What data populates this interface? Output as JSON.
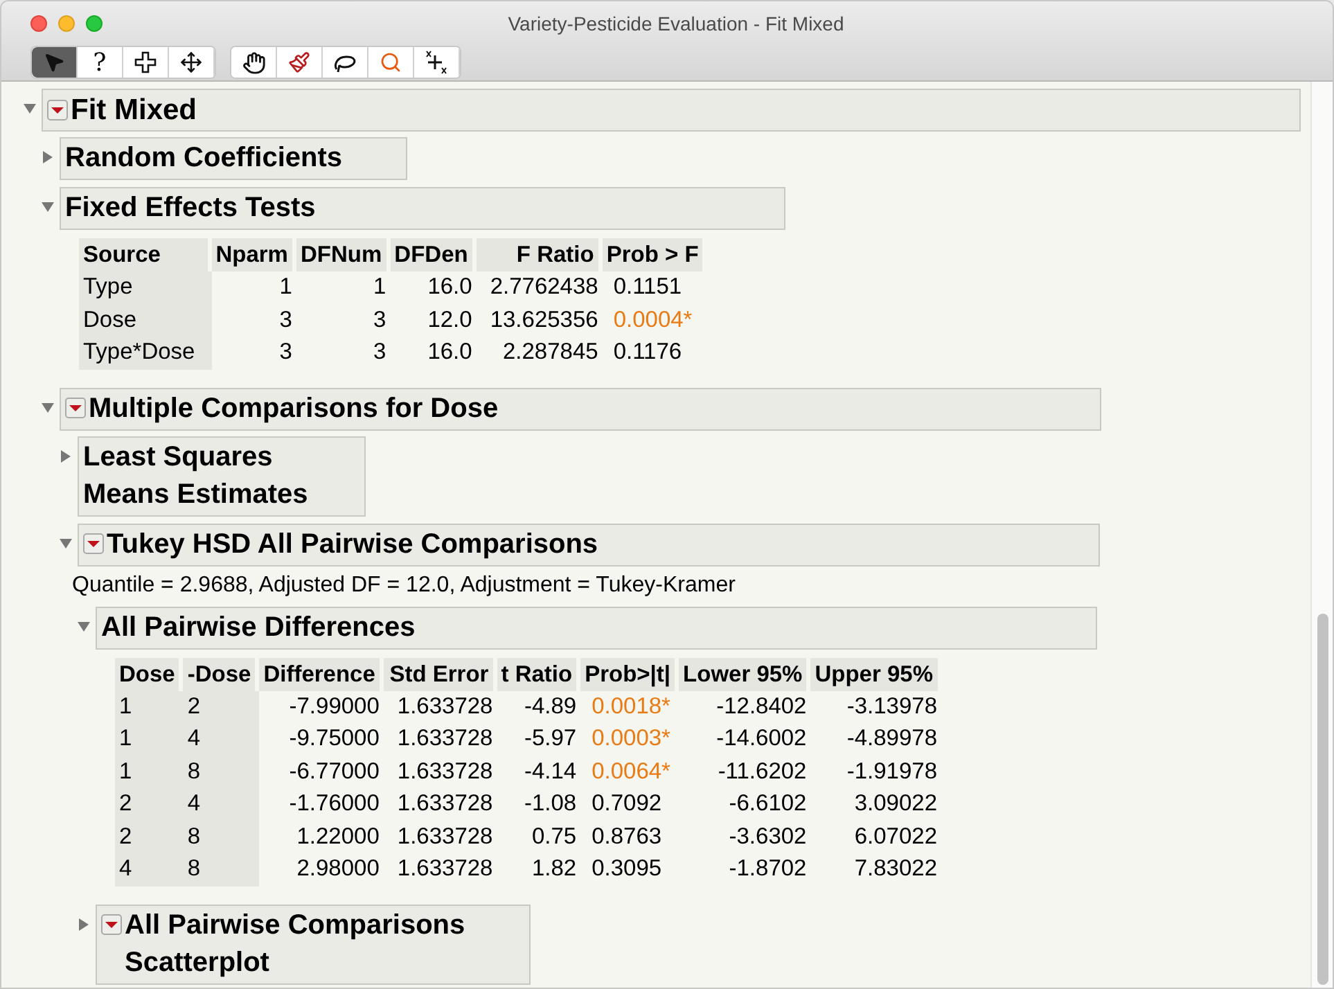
{
  "window": {
    "title": "Variety-Pesticide Evaluation - Fit Mixed"
  },
  "toolbar": [
    {
      "selected": true
    },
    {
      "selected": false,
      "label": "?"
    },
    {
      "selected": false
    },
    {
      "selected": false
    },
    {
      "selected": false
    },
    {
      "selected": false
    },
    {
      "selected": false
    },
    {
      "selected": false
    },
    {
      "selected": false
    }
  ],
  "report": {
    "kind": "outline",
    "title": "Fit Mixed",
    "expanded": true,
    "menu": true,
    "children": [
      {
        "kind": "outline",
        "title": "Random Coefficients",
        "expanded": false,
        "menu": false
      },
      {
        "kind": "outline",
        "title": "Fixed Effects Tests",
        "expanded": true,
        "menu": false,
        "children": [
          {
            "kind": "table",
            "columns": [
              {
                "label": "Source",
                "kind": "label"
              },
              {
                "label": "Nparm",
                "kind": "number"
              },
              {
                "label": "DFNum",
                "kind": "number"
              },
              {
                "label": "DFDen",
                "kind": "number"
              },
              {
                "label": "F Ratio",
                "kind": "number"
              },
              {
                "label": "Prob > F",
                "kind": "pvalue"
              }
            ],
            "rows": [
              {
                "cells": [
                  {
                    "text": "Type"
                  },
                  {
                    "text": "1"
                  },
                  {
                    "text": "1"
                  },
                  {
                    "text": "16.0"
                  },
                  {
                    "text": "2.7762438"
                  },
                  {
                    "text": "0.1151",
                    "significant": false
                  }
                ]
              },
              {
                "cells": [
                  {
                    "text": "Dose"
                  },
                  {
                    "text": "3"
                  },
                  {
                    "text": "3"
                  },
                  {
                    "text": "12.0"
                  },
                  {
                    "text": "13.625356"
                  },
                  {
                    "text": "0.0004*",
                    "significant": true
                  }
                ]
              },
              {
                "cells": [
                  {
                    "text": "Type*Dose"
                  },
                  {
                    "text": "3"
                  },
                  {
                    "text": "3"
                  },
                  {
                    "text": "16.0"
                  },
                  {
                    "text": "2.287845"
                  },
                  {
                    "text": "0.1176",
                    "significant": false
                  }
                ]
              }
            ]
          }
        ]
      },
      {
        "kind": "outline",
        "title": "Multiple Comparisons for Dose",
        "expanded": true,
        "menu": true,
        "children": [
          {
            "kind": "outline",
            "title": "Least Squares Means Estimates",
            "expanded": false,
            "menu": false
          },
          {
            "kind": "outline",
            "title": "Tukey HSD All Pairwise Comparisons",
            "expanded": true,
            "menu": true,
            "children": [
              {
                "kind": "note",
                "text": "Quantile = 2.9688, Adjusted DF = 12.0, Adjustment = Tukey-Kramer"
              },
              {
                "kind": "outline",
                "title": "All Pairwise Differences",
                "expanded": true,
                "menu": false,
                "children": [
                  {
                    "kind": "table",
                    "columns": [
                      {
                        "label": "Dose",
                        "kind": "label"
                      },
                      {
                        "label": "-Dose",
                        "kind": "label"
                      },
                      {
                        "label": "Difference",
                        "kind": "number"
                      },
                      {
                        "label": "Std Error",
                        "kind": "number"
                      },
                      {
                        "label": "t Ratio",
                        "kind": "number"
                      },
                      {
                        "label": "Prob>|t|",
                        "kind": "pvalue"
                      },
                      {
                        "label": "Lower 95%",
                        "kind": "number"
                      },
                      {
                        "label": "Upper 95%",
                        "kind": "number"
                      }
                    ],
                    "rows": [
                      {
                        "cells": [
                          {
                            "text": "1"
                          },
                          {
                            "text": "2"
                          },
                          {
                            "text": "-7.99000"
                          },
                          {
                            "text": "1.633728"
                          },
                          {
                            "text": "-4.89"
                          },
                          {
                            "text": "0.0018*",
                            "significant": true
                          },
                          {
                            "text": "-12.8402"
                          },
                          {
                            "text": "-3.13978"
                          }
                        ]
                      },
                      {
                        "cells": [
                          {
                            "text": "1"
                          },
                          {
                            "text": "4"
                          },
                          {
                            "text": "-9.75000"
                          },
                          {
                            "text": "1.633728"
                          },
                          {
                            "text": "-5.97"
                          },
                          {
                            "text": "0.0003*",
                            "significant": true
                          },
                          {
                            "text": "-14.6002"
                          },
                          {
                            "text": "-4.89978"
                          }
                        ]
                      },
                      {
                        "cells": [
                          {
                            "text": "1"
                          },
                          {
                            "text": "8"
                          },
                          {
                            "text": "-6.77000"
                          },
                          {
                            "text": "1.633728"
                          },
                          {
                            "text": "-4.14"
                          },
                          {
                            "text": "0.0064*",
                            "significant": true
                          },
                          {
                            "text": "-11.6202"
                          },
                          {
                            "text": "-1.91978"
                          }
                        ]
                      },
                      {
                        "cells": [
                          {
                            "text": "2"
                          },
                          {
                            "text": "4"
                          },
                          {
                            "text": "-1.76000"
                          },
                          {
                            "text": "1.633728"
                          },
                          {
                            "text": "-1.08"
                          },
                          {
                            "text": "0.7092",
                            "significant": false
                          },
                          {
                            "text": "-6.6102"
                          },
                          {
                            "text": "3.09022"
                          }
                        ]
                      },
                      {
                        "cells": [
                          {
                            "text": "2"
                          },
                          {
                            "text": "8"
                          },
                          {
                            "text": "1.22000"
                          },
                          {
                            "text": "1.633728"
                          },
                          {
                            "text": "0.75"
                          },
                          {
                            "text": "0.8763",
                            "significant": false
                          },
                          {
                            "text": "-3.6302"
                          },
                          {
                            "text": "6.07022"
                          }
                        ]
                      },
                      {
                        "cells": [
                          {
                            "text": "4"
                          },
                          {
                            "text": "8"
                          },
                          {
                            "text": "2.98000"
                          },
                          {
                            "text": "1.633728"
                          },
                          {
                            "text": "1.82"
                          },
                          {
                            "text": "0.3095",
                            "significant": false
                          },
                          {
                            "text": "-1.8702"
                          },
                          {
                            "text": "7.83022"
                          }
                        ]
                      }
                    ]
                  }
                ]
              },
              {
                "kind": "outline",
                "title": "All Pairwise Comparisons Scatterplot",
                "expanded": false,
                "menu": true
              }
            ]
          }
        ]
      }
    ]
  }
}
